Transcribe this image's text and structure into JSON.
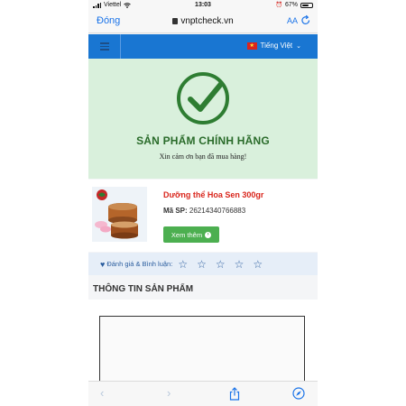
{
  "status_bar": {
    "carrier": "Viettel",
    "time": "13:03",
    "battery": "67%",
    "battery_level": 0.67
  },
  "browser": {
    "done_label": "Đóng",
    "url": "vnptcheck.vn",
    "text_size_label": "AA"
  },
  "navbar": {
    "language": "Tiếng Việt"
  },
  "verification": {
    "title": "SẢN PHẨM CHÍNH HÃNG",
    "subtitle": "Xin cảm ơn bạn đã mua hàng!",
    "status_color": "#2e7d32"
  },
  "product": {
    "name": "Dưỡng thể Hoa Sen 300gr",
    "sku_label": "Mã SP:",
    "sku_value": "26214340766883",
    "more_button": "Xem thêm"
  },
  "rating": {
    "label": "Đánh giá & Bình luận:",
    "stars_filled": 0,
    "stars_total": 5
  },
  "info": {
    "title": "THÔNG TIN SẢN PHẨM"
  },
  "icons": {
    "menu": "hamburger-icon",
    "check": "check-circle-icon",
    "share": "share-icon",
    "compass": "compass-icon"
  },
  "colors": {
    "navbar": "#1976d2",
    "banner": "#d9f0dc",
    "product_name": "#d9261c",
    "button": "#4caf50"
  }
}
